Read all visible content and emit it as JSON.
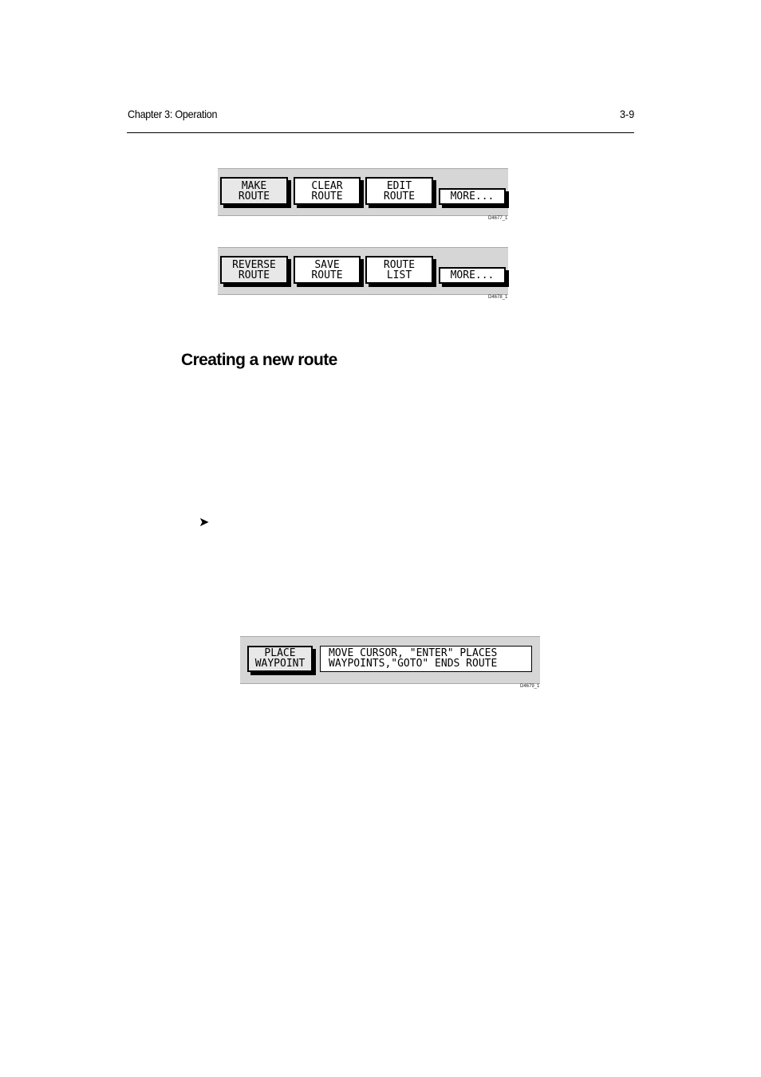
{
  "header": {
    "chapter": "Chapter 3: Operation",
    "page_number": "3-9"
  },
  "figures": [
    {
      "id": "D4677_1",
      "keys": [
        {
          "line1": "MAKE",
          "line2": "ROUTE"
        },
        {
          "line1": "CLEAR",
          "line2": "ROUTE"
        },
        {
          "line1": "EDIT",
          "line2": "ROUTE"
        },
        {
          "line1": "",
          "line2": "MORE..."
        }
      ]
    },
    {
      "id": "D4678_1",
      "keys": [
        {
          "line1": "REVERSE",
          "line2": "ROUTE"
        },
        {
          "line1": "SAVE",
          "line2": "ROUTE"
        },
        {
          "line1": "ROUTE",
          "line2": "LIST"
        },
        {
          "line1": "",
          "line2": "MORE..."
        }
      ]
    },
    {
      "id": "D4679_1",
      "keys": [
        {
          "line1": "PLACE",
          "line2": "WAYPOINT"
        }
      ],
      "message": {
        "line1": "MOVE CURSOR, \"ENTER\" PLACES",
        "line2": "WAYPOINTS,\"GOTO\" ENDS ROUTE"
      }
    }
  ],
  "section": {
    "title": "Creating a new route",
    "bullet_icon": "➤"
  }
}
